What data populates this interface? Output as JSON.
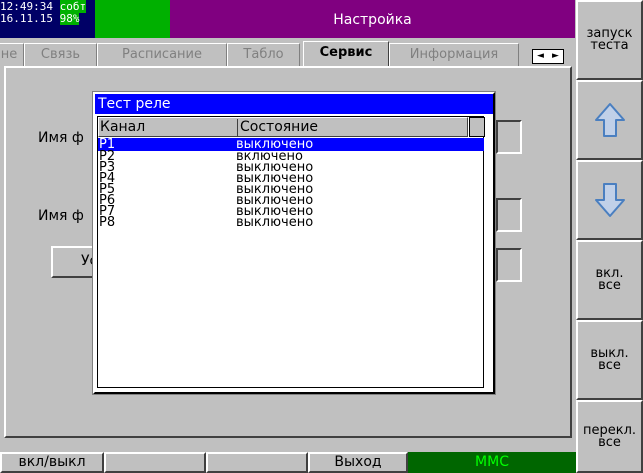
{
  "status": {
    "time": "12:49:34",
    "conn": "сoбт",
    "date": "16.11.15",
    "battery": "98%"
  },
  "title": "Настройка",
  "tabs": [
    "не",
    "Связь",
    "Расписание",
    "Табло",
    "Сервис",
    "Информация"
  ],
  "active_tab": "Сервис",
  "tab_arrows": {
    "left": "◄",
    "right": "►"
  },
  "background": {
    "label1": "Имя ф",
    "label2": "Имя ф",
    "button": "Ус"
  },
  "dialog": {
    "title": "Тест реле",
    "columns": [
      "Канал",
      "Состояние"
    ],
    "rows": [
      {
        "channel": "P1",
        "state": "выключено",
        "selected": true
      },
      {
        "channel": "P2",
        "state": "включено"
      },
      {
        "channel": "P3",
        "state": "выключено"
      },
      {
        "channel": "P4",
        "state": "выключено"
      },
      {
        "channel": "P5",
        "state": "выключено"
      },
      {
        "channel": "P6",
        "state": "выключено"
      },
      {
        "channel": "P7",
        "state": "выключено"
      },
      {
        "channel": "P8",
        "state": "выключено"
      }
    ]
  },
  "side_buttons": {
    "start_test": "запуск теста",
    "up": "up-arrow-icon",
    "down": "down-arrow-icon",
    "all_on": "вкл. все",
    "all_off": "выкл. все",
    "toggle_all": "перекл. все"
  },
  "bottom": {
    "onoff": "вкл/выкл",
    "blank1": "",
    "blank2": "",
    "exit": "Выход",
    "mmc": "MMC"
  },
  "colors": {
    "title_bar": "#800080",
    "status_green": "#00b000",
    "dialog_title": "#0000ff",
    "arrow_blue": "#4a7fc0",
    "mmc_bg": "#006600",
    "mmc_fg": "#00ff00"
  }
}
